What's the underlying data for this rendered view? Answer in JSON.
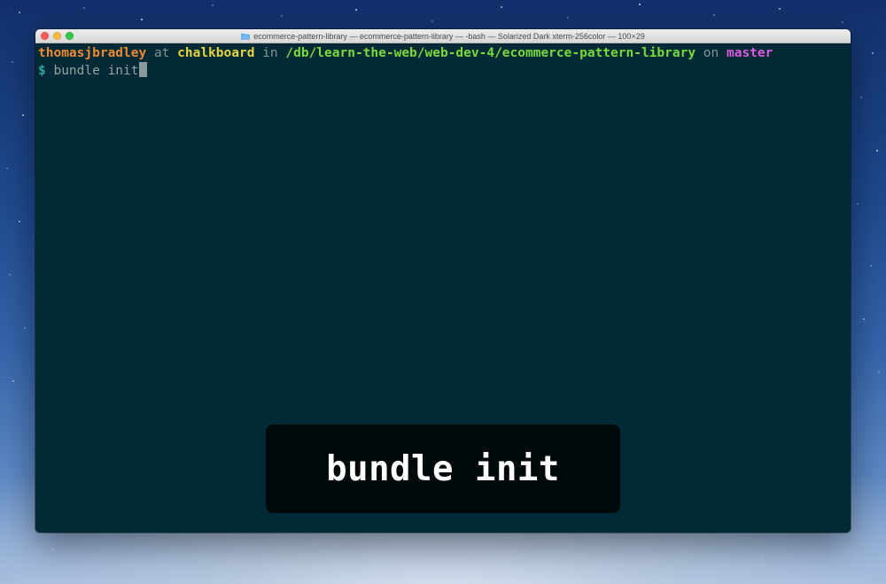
{
  "window": {
    "title": "ecommerce-pattern-library — ecommerce-pattern-library — -bash — Solarized Dark xterm-256color — 100×29",
    "title_icon": "folder-icon"
  },
  "prompt": {
    "user": "thomasjbradley",
    "at": " at ",
    "host": "chalkboard",
    "in": " in ",
    "path": "/db/learn-the-web/web-dev-4/ecommerce-pattern-library",
    "on": " on ",
    "branch": "master",
    "symbol": "$",
    "command": " bundle init"
  },
  "caption": {
    "text": "bundle init"
  },
  "colors": {
    "terminal_bg": "#002b36",
    "user": "#f08a32",
    "host": "#e7d33d",
    "path": "#7ad93b",
    "branch": "#df5adf",
    "dollar": "#2aa6a6",
    "caption_bg": "#02090b"
  }
}
